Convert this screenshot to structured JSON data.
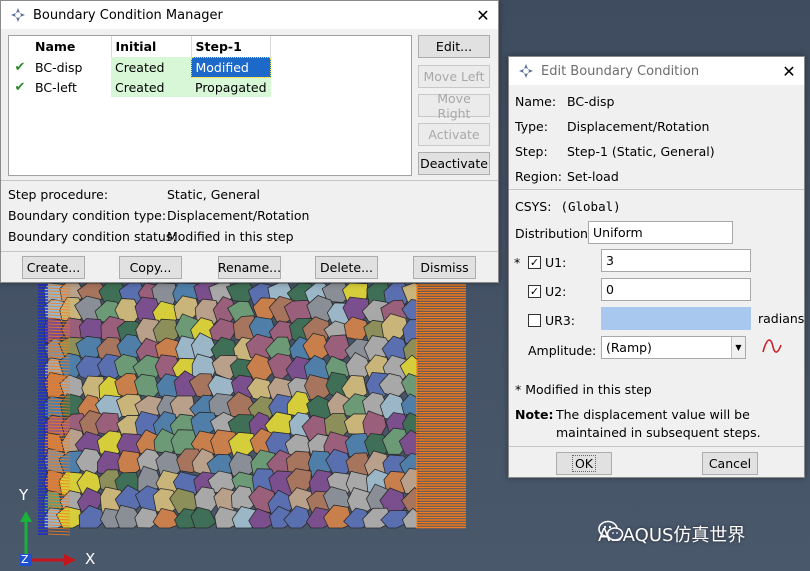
{
  "viewport": {
    "triad": {
      "y_label": "Y",
      "z_label": "Z",
      "x_label": "X"
    },
    "watermark": {
      "text": "ABAQUS仿真世界",
      "icon": "wechat-icon"
    },
    "colors": {
      "background": "#45526a",
      "bc_left_lines": "#1a2bd0",
      "bc_right_lines": "#f47b1a"
    }
  },
  "bc_manager": {
    "title": "Boundary Condition Manager",
    "columns": [
      "Name",
      "Initial",
      "Step-1"
    ],
    "rows": [
      {
        "check": "✔",
        "name": "BC-disp",
        "initial": "Created",
        "step1": "Modified",
        "selected": true
      },
      {
        "check": "✔",
        "name": "BC-left",
        "initial": "Created",
        "step1": "Propagated",
        "selected": false
      }
    ],
    "side_buttons": {
      "edit": "Edit...",
      "move_left": "Move Left",
      "move_right": "Move Right",
      "activate": "Activate",
      "deactivate": "Deactivate"
    },
    "info": {
      "step_procedure_label": "Step procedure:",
      "step_procedure_value": "Static, General",
      "bc_type_label": "Boundary condition type:",
      "bc_type_value": "Displacement/Rotation",
      "bc_status_label": "Boundary condition status:",
      "bc_status_value": "Modified in this step"
    },
    "bottom_buttons": {
      "create": "Create...",
      "copy": "Copy...",
      "rename": "Rename...",
      "delete": "Delete...",
      "dismiss": "Dismiss"
    }
  },
  "edit_bc": {
    "title": "Edit Boundary Condition",
    "name_label": "Name:",
    "name_value": "BC-disp",
    "type_label": "Type:",
    "type_value": "Displacement/Rotation",
    "step_label": "Step:",
    "step_value": "Step-1 (Static, General)",
    "region_label": "Region:",
    "region_value": "Set-load",
    "csys_label": "CSYS:",
    "csys_value": "(Global)",
    "distribution_label": "Distribution:",
    "distribution_value": "Uniform",
    "u1": {
      "marker": "*",
      "label": "U1:",
      "checked": true,
      "value": "3"
    },
    "u2": {
      "label": "U2:",
      "checked": true,
      "value": "0"
    },
    "ur3": {
      "label": "UR3:",
      "checked": false,
      "value": "",
      "unit": "radians"
    },
    "amplitude_label": "Amplitude:",
    "amplitude_value": "(Ramp)",
    "modified_note": "* Modified in this step",
    "note_label": "Note:",
    "note_line1": "The displacement value will be",
    "note_line2": "maintained in subsequent steps.",
    "ok_label": "OK",
    "cancel_label": "Cancel"
  }
}
